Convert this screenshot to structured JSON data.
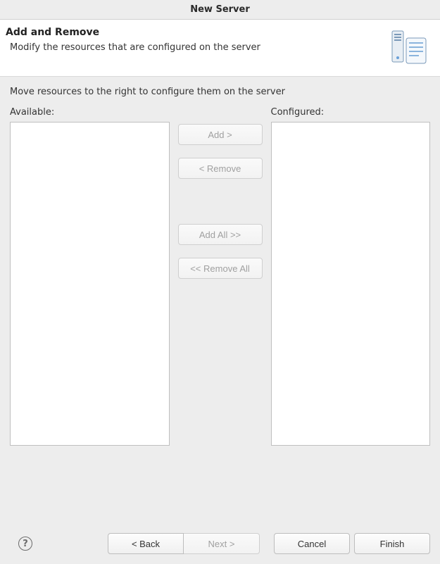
{
  "window": {
    "title": "New Server"
  },
  "banner": {
    "title": "Add and Remove",
    "subtitle": "Modify the resources that are configured on the server"
  },
  "content": {
    "instruction": "Move resources to the right to configure them on the server",
    "available_label": "Available:",
    "configured_label": "Configured:",
    "available_items": [],
    "configured_items": []
  },
  "buttons": {
    "add": "Add >",
    "remove": "< Remove",
    "add_all": "Add All >>",
    "remove_all": "<< Remove All",
    "back": "< Back",
    "next": "Next >",
    "cancel": "Cancel",
    "finish": "Finish"
  },
  "state": {
    "add_enabled": false,
    "remove_enabled": false,
    "add_all_enabled": false,
    "remove_all_enabled": false,
    "next_enabled": false
  },
  "help_glyph": "?"
}
